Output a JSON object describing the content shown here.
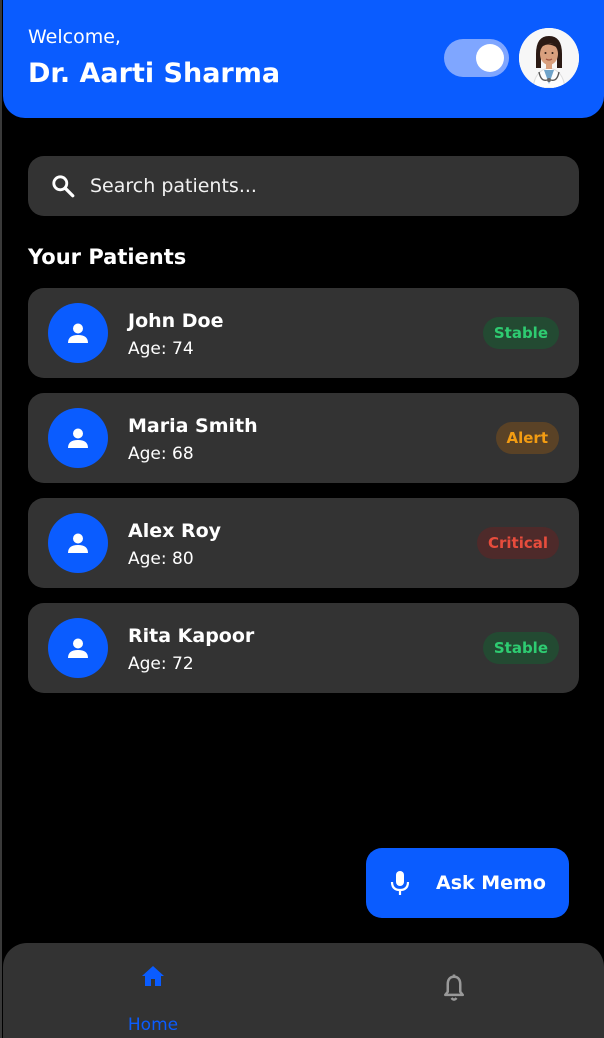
{
  "header": {
    "welcome": "Welcome,",
    "doctor_name": "Dr. Aarti Sharma",
    "toggle_on": true
  },
  "search": {
    "placeholder": "Search patients...",
    "value": ""
  },
  "section_title": "Your Patients",
  "patients": [
    {
      "name": "John Doe",
      "age": "Age: 74",
      "status": "Stable"
    },
    {
      "name": "Maria Smith",
      "age": "Age: 68",
      "status": "Alert"
    },
    {
      "name": "Alex Roy",
      "age": "Age: 80",
      "status": "Critical"
    },
    {
      "name": "Rita Kapoor",
      "age": "Age: 72",
      "status": "Stable"
    }
  ],
  "fab": {
    "label": "Ask Memo",
    "icon": "mic-icon"
  },
  "bottom_nav": {
    "items": [
      {
        "label": "Home",
        "icon": "home-icon",
        "active": true
      },
      {
        "label": "",
        "icon": "bell-icon",
        "active": false
      }
    ]
  },
  "colors": {
    "accent": "#0a5cff",
    "card": "#333333",
    "background": "#000000",
    "stable": "#2ecc71",
    "alert": "#f39c12",
    "critical": "#e74c3c"
  }
}
